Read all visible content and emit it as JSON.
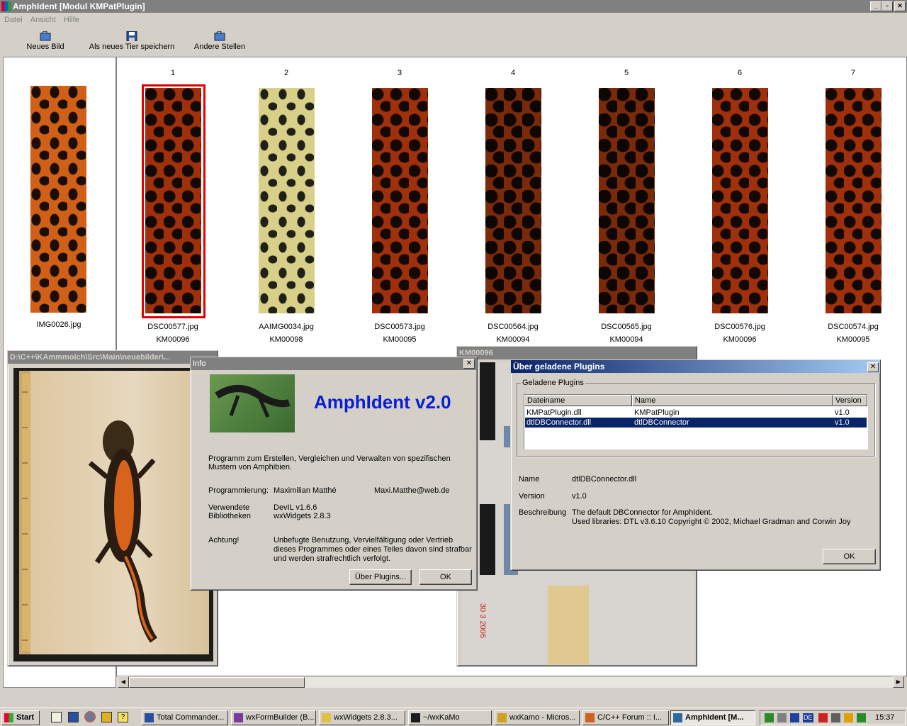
{
  "app": {
    "title": "AmphIdent [Modul KMPatPlugin]"
  },
  "window_controls": {
    "minimize": "_",
    "maximize": "▫",
    "close": "✕"
  },
  "menu": [
    "Datei",
    "Ansicht",
    "Hilfe"
  ],
  "toolbar": {
    "new_image": "Neues Bild",
    "save_new_animal": "Als neues Tier speichern",
    "other_locations": "Andere Stellen"
  },
  "query": {
    "filename": "IMG0026.jpg"
  },
  "results": [
    {
      "rank": "1",
      "file": "DSC00577.jpg",
      "id": "KM00096",
      "selected": true,
      "pattern": "red"
    },
    {
      "rank": "2",
      "file": "AAIMG0034.jpg",
      "id": "KM00098",
      "selected": false,
      "pattern": "yellow"
    },
    {
      "rank": "3",
      "file": "DSC00573.jpg",
      "id": "KM00095",
      "selected": false,
      "pattern": "red"
    },
    {
      "rank": "4",
      "file": "DSC00564.jpg",
      "id": "KM00094",
      "selected": false,
      "pattern": "dark"
    },
    {
      "rank": "5",
      "file": "DSC00565.jpg",
      "id": "KM00094",
      "selected": false,
      "pattern": "dark"
    },
    {
      "rank": "6",
      "file": "DSC00576.jpg",
      "id": "KM00096",
      "selected": false,
      "pattern": "red"
    },
    {
      "rank": "7",
      "file": "DSC00574.jpg",
      "id": "KM00095",
      "selected": false,
      "pattern": "red"
    }
  ],
  "image_window_left": {
    "title": "D:\\C++\\KAmmmolch\\Src\\Main\\neuebilder\\..."
  },
  "image_window_right": {
    "title": "KM00096",
    "date_stamp": "30 3 2006"
  },
  "info_dialog": {
    "title": "Info",
    "app_name": "AmphIdent v2.0",
    "description": "Programm zum Erstellen, Vergleichen und Verwalten von spezifischen Mustern von Amphibien.",
    "programming_label": "Programmierung:",
    "programmer": "Maximilian Matthé",
    "email": "Maxi.Matthe@web.de",
    "libs_label": "Verwendete Bibliotheken",
    "libs_line1": "DevIL v1.6.6",
    "libs_line2": "wxWidgets 2.8.3",
    "warning_label": "Achtung!",
    "warning_text": "Unbefugte Benutzung, Vervielfältigung oder Vertrieb dieses Programmes oder eines Teiles davon sind strafbar und werden strafrechtlich verfolgt.",
    "plugins_button": "Über Plugins...",
    "ok_button": "OK"
  },
  "plugins_dialog": {
    "title": "Über geladene Plugins",
    "group_label": "Geladene Plugins",
    "columns": [
      "Dateiname",
      "Name",
      "Version"
    ],
    "rows": [
      {
        "file": "KMPatPlugin.dll",
        "name": "KMPatPlugin",
        "version": "v1.0",
        "selected": false
      },
      {
        "file": "dtlDBConnector.dll",
        "name": "dtlDBConnector",
        "version": "v1.0",
        "selected": true
      }
    ],
    "name_label": "Name",
    "name_value": "dtlDBConnector.dll",
    "version_label": "Version",
    "version_value": "v1.0",
    "desc_label": "Beschreibung",
    "desc_line1": "The default DBConnector for AmphIdent.",
    "desc_line2": "Used libraries: DTL v3.6.10 Copyright © 2002, Michael Gradman and Corwin Joy",
    "ok_button": "OK"
  },
  "taskbar": {
    "start": "Start",
    "tasks": [
      "Total Commander...",
      "wxFormBuilder (B...",
      "wxWidgets 2.8.3...",
      "~/wxKaMo",
      "wxKamo - Micros...",
      "C/C++ Forum :: I...",
      "AmphIdent [M..."
    ],
    "tray_lang": "DE",
    "clock": "15:37"
  }
}
